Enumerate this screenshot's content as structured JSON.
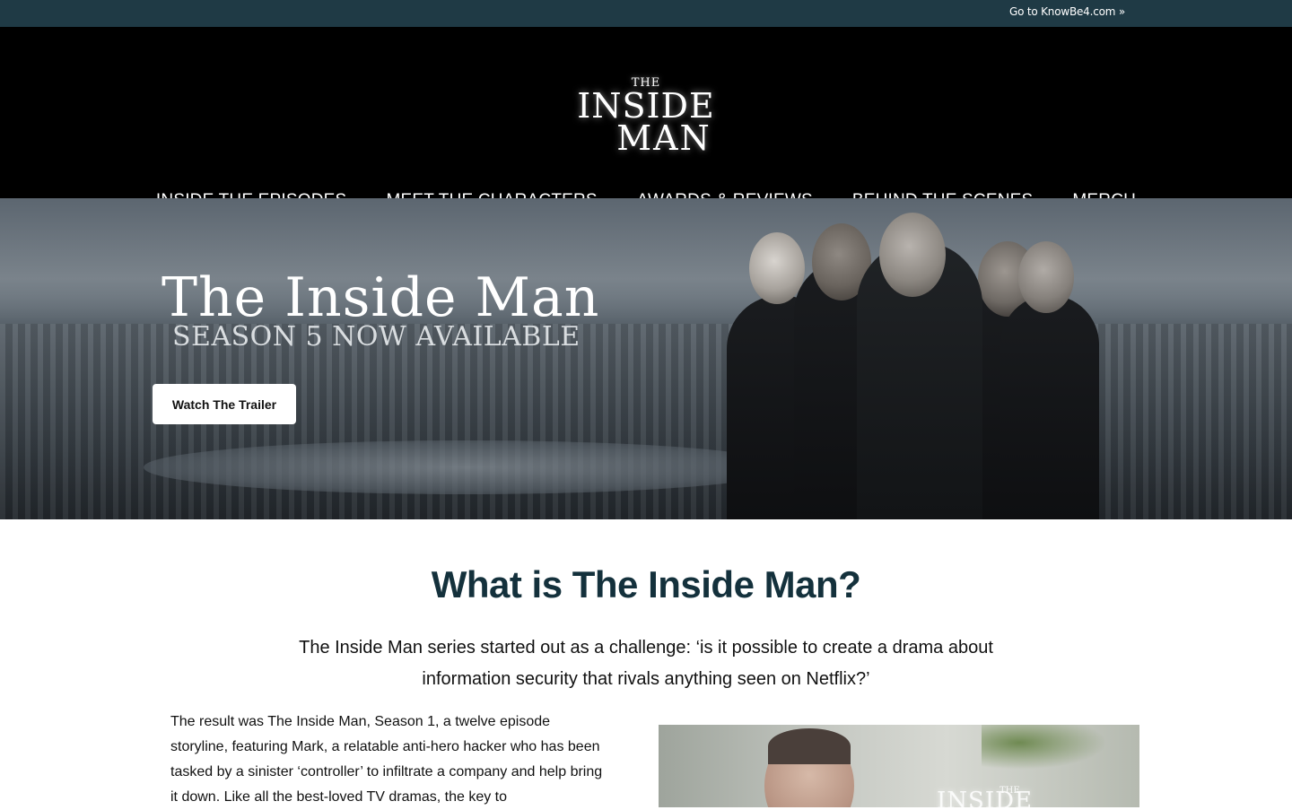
{
  "topbar": {
    "link_label": "Go to KnowBe4.com »"
  },
  "logo": {
    "the": "THE",
    "inside": "INSIDE",
    "man": "MAN"
  },
  "nav": {
    "items": [
      {
        "label": "INSIDE THE EPISODES"
      },
      {
        "label": "MEET THE CHARACTERS"
      },
      {
        "label": "AWARDS & REVIEWS"
      },
      {
        "label": "BEHIND THE SCENES"
      },
      {
        "label": "MERCH"
      }
    ]
  },
  "hero": {
    "title": "The Inside Man",
    "subtitle": "SEASON 5 NOW AVAILABLE",
    "button_label": "Watch The Trailer"
  },
  "intro": {
    "heading": "What is The Inside Man?",
    "lead": "The Inside Man series started out as a challenge: ‘is it possible to create a drama about information security that rivals anything seen on Netflix?’",
    "body": "The result was The Inside Man, Season 1, a twelve episode storyline, featuring Mark, a relatable anti-hero hacker who has been tasked by a sinister ‘controller’ to infiltrate a company and help bring it down. Like all the best-loved TV dramas, the key to"
  },
  "video": {
    "logo_the": "THE",
    "logo_text": "INSIDE"
  },
  "colors": {
    "topbar": "#1f3a45",
    "header": "#000000",
    "heading": "#14313c"
  }
}
